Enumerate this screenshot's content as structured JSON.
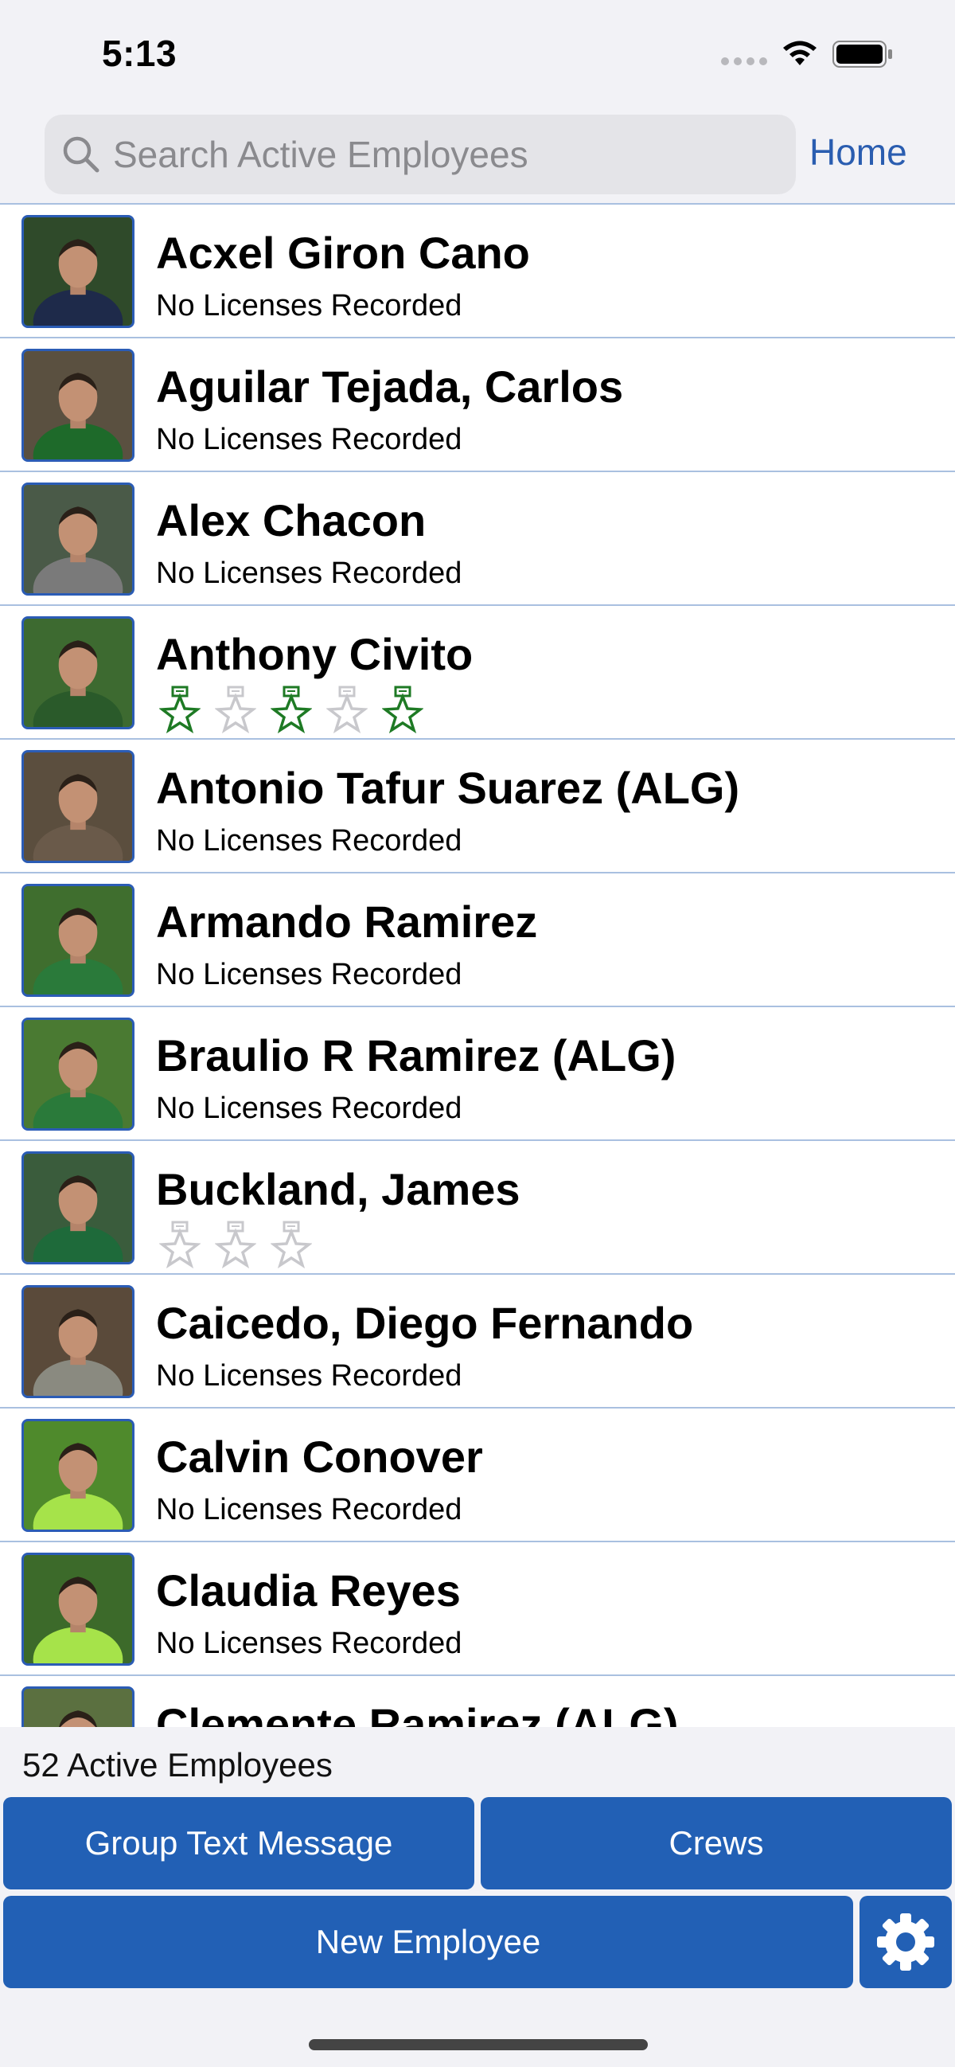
{
  "status_bar": {
    "time": "5:13"
  },
  "header": {
    "search_placeholder": "Search Active Employees",
    "home_label": "Home"
  },
  "colors": {
    "accent": "#2260b5",
    "link": "#2a5db0",
    "badge_green": "#1e7a24",
    "badge_gray": "#c8c8cc",
    "divider": "#a9c0e0"
  },
  "employees": [
    {
      "name": "Acxel Giron Cano",
      "subtitle": "No Licenses Recorded",
      "badges": []
    },
    {
      "name": "Aguilar Tejada, Carlos",
      "subtitle": "No Licenses Recorded",
      "badges": []
    },
    {
      "name": "Alex Chacon",
      "subtitle": "No Licenses Recorded",
      "badges": []
    },
    {
      "name": "Anthony Civito",
      "subtitle": "",
      "badges": [
        "green",
        "gray",
        "green",
        "gray",
        "green"
      ]
    },
    {
      "name": "Antonio Tafur Suarez (ALG)",
      "subtitle": "No Licenses Recorded",
      "badges": []
    },
    {
      "name": "Armando Ramirez",
      "subtitle": "No Licenses Recorded",
      "badges": []
    },
    {
      "name": "Braulio R Ramirez (ALG)",
      "subtitle": "No Licenses Recorded",
      "badges": []
    },
    {
      "name": "Buckland, James",
      "subtitle": "",
      "badges": [
        "gray",
        "gray",
        "gray"
      ]
    },
    {
      "name": "Caicedo, Diego Fernando",
      "subtitle": "No Licenses Recorded",
      "badges": []
    },
    {
      "name": "Calvin Conover",
      "subtitle": "No Licenses Recorded",
      "badges": []
    },
    {
      "name": "Claudia Reyes",
      "subtitle": "No Licenses Recorded",
      "badges": []
    },
    {
      "name": "Clemente Ramirez (ALG)",
      "subtitle": "",
      "badges": []
    }
  ],
  "footer": {
    "count_label": "52 Active Employees",
    "group_text_label": "Group Text Message",
    "crews_label": "Crews",
    "new_employee_label": "New Employee"
  }
}
